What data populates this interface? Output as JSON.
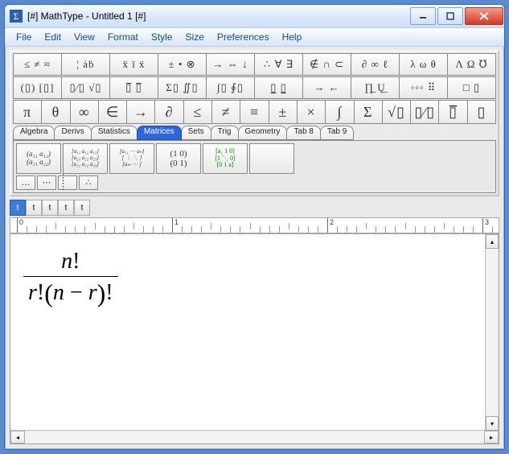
{
  "window": {
    "title": "[#] MathType - Untitled 1 [#]"
  },
  "menu": [
    "File",
    "Edit",
    "View",
    "Format",
    "Style",
    "Size",
    "Preferences",
    "Help"
  ],
  "toolbar": {
    "row1": [
      "≤ ≠ ≈",
      "¦ ȧḃ",
      "ẍ ï ẍ",
      "± • ⊗",
      "→ ⇔ ↓",
      "∴ ∀ ∃",
      "∉ ∩ ⊂",
      "∂ ∞ ℓ",
      "λ ω θ",
      "Λ Ω ℧"
    ],
    "row2": [
      "(▯) [▯]",
      "▯⁄▯ √▯",
      "▯̅ ▯̅",
      "Σ▯ ∬▯",
      "∫▯ ∮▯",
      "▯̲  ▯̲",
      "→ ←",
      "∏̲  Ų̲",
      "◦◦◦ ⠿",
      "□ ▯"
    ],
    "row3": [
      "π",
      "θ",
      "∞",
      "∈",
      "→",
      "∂",
      "≤",
      "≠",
      "≡",
      "±",
      "×",
      "∫",
      "Σ",
      "√▯",
      "▯⁄▯",
      "▯̅",
      "▯"
    ]
  },
  "tabs": {
    "items": [
      "Algebra",
      "Derivs",
      "Statistics",
      "Matrices",
      "Sets",
      "Trig",
      "Geometry",
      "Tab 8",
      "Tab 9"
    ],
    "selected": 3,
    "matrix_buttons_top": [
      "2x2-a",
      "3x3-a",
      "n-col-a",
      "identity",
      "dots-4",
      "empty"
    ],
    "matrix_buttons_bot": [
      "…",
      "⋯",
      "⋮ ⋮",
      "∴"
    ]
  },
  "smallbar": [
    "t",
    "t",
    "t",
    "t",
    "t"
  ],
  "ruler": {
    "majors": [
      "0",
      "1",
      "2",
      "3"
    ],
    "pxPerUnit": 193
  },
  "equation": {
    "numerator": "n!",
    "denominator": "r!(n−r)!"
  }
}
